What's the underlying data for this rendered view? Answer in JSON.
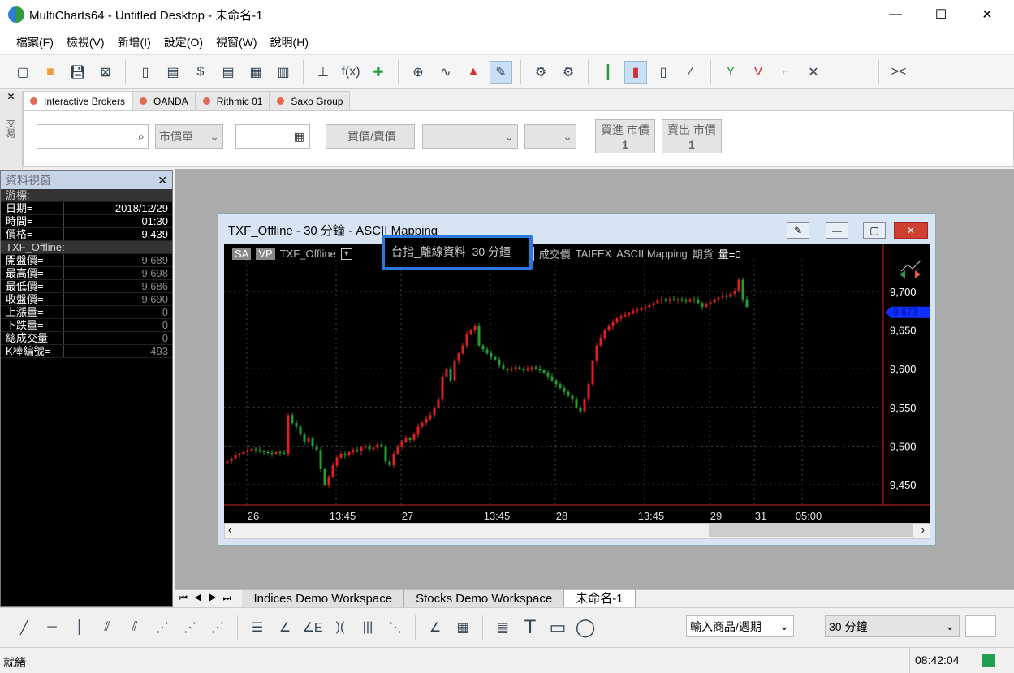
{
  "window": {
    "title": "MultiCharts64 - Untitled Desktop - 未命名-1",
    "minimize": "—",
    "maximize": "☐",
    "close": "✕"
  },
  "menu": [
    "檔案(F)",
    "檢視(V)",
    "新增(I)",
    "設定(O)",
    "視窗(W)",
    "說明(H)"
  ],
  "broker_tabs": [
    "Interactive Brokers",
    "OANDA",
    "Rithmic 01",
    "Saxo Group"
  ],
  "order_bar": {
    "side_label": "交易",
    "search_placeholder": "",
    "order_type": "市價單",
    "buysell_label": "買價/賣價",
    "buy_button": "買進 市價",
    "buy_qty": "1",
    "sell_button": "賣出 市價",
    "sell_qty": "1"
  },
  "data_window": {
    "title": "資料視窗",
    "cursor_section": "游標:",
    "cursor_rows": [
      {
        "k": "日期=",
        "v": "2018/12/29"
      },
      {
        "k": "時間=",
        "v": "01:30"
      },
      {
        "k": "價格=",
        "v": "9,439"
      }
    ],
    "symbol_section": "TXF_Offline:",
    "symbol_rows": [
      {
        "k": "開盤價=",
        "v": "9,689"
      },
      {
        "k": "最高價=",
        "v": "9,698"
      },
      {
        "k": "最低價=",
        "v": "9,686"
      },
      {
        "k": "收盤價=",
        "v": "9,690"
      },
      {
        "k": "上漲量=",
        "v": "0"
      },
      {
        "k": "下跌量=",
        "v": "0"
      },
      {
        "k": "總成交量",
        "v": "0"
      },
      {
        "k": "K棒編號=",
        "v": "493"
      }
    ]
  },
  "chart_window": {
    "title": "TXF_Offline - 30 分鐘 - ASCII Mapping",
    "status_line": {
      "sa": "SA",
      "vp": "VP",
      "symbol": "TXF_Offline",
      "desc": "台指_離線資料",
      "interval": "30 分鐘",
      "r": "R",
      "price_type": "成交價",
      "exchange": "TAIFEX",
      "source": "ASCII Mapping",
      "category": "期貨",
      "volume": "量=0"
    }
  },
  "chart_data": {
    "type": "candlestick",
    "y_ticks": [
      9450,
      9500,
      9550,
      9600,
      9650,
      9700
    ],
    "y_tick_labels": [
      "9,450",
      "9,500",
      "9,550",
      "9,600",
      "9,650",
      "9,700"
    ],
    "ylim": [
      9420,
      9740
    ],
    "x_tick_labels": [
      "26",
      "13:45",
      "27",
      "13:45",
      "28",
      "13:45",
      "29",
      "31",
      "05:00"
    ],
    "last_price_label": "9,673",
    "colors": {
      "up": "#e02020",
      "down": "#20a030",
      "axis": "#d02020",
      "last": "#1030ff"
    },
    "closes": [
      9480,
      9484,
      9488,
      9490,
      9492,
      9494,
      9496,
      9495,
      9493,
      9492,
      9491,
      9490,
      9492,
      9491,
      9490,
      9540,
      9530,
      9525,
      9515,
      9505,
      9510,
      9500,
      9495,
      9470,
      9450,
      9460,
      9475,
      9485,
      9490,
      9488,
      9492,
      9495,
      9493,
      9498,
      9500,
      9496,
      9498,
      9502,
      9500,
      9480,
      9475,
      9490,
      9500,
      9505,
      9510,
      9508,
      9515,
      9525,
      9530,
      9535,
      9540,
      9550,
      9560,
      9590,
      9600,
      9585,
      9610,
      9620,
      9630,
      9645,
      9650,
      9655,
      9630,
      9625,
      9620,
      9615,
      9612,
      9605,
      9600,
      9598,
      9600,
      9602,
      9600,
      9598,
      9600,
      9602,
      9600,
      9598,
      9595,
      9590,
      9585,
      9580,
      9575,
      9570,
      9565,
      9560,
      9550,
      9545,
      9560,
      9580,
      9610,
      9630,
      9640,
      9650,
      9655,
      9660,
      9665,
      9668,
      9670,
      9672,
      9675,
      9676,
      9678,
      9680,
      9682,
      9685,
      9688,
      9690,
      9688,
      9690,
      9689,
      9690,
      9688,
      9687,
      9690,
      9689,
      9685,
      9680,
      9683,
      9686,
      9690,
      9692,
      9695,
      9693,
      9697,
      9700,
      9715,
      9690,
      9680
    ]
  },
  "workspace_tabs": [
    "Indices Demo Workspace",
    "Stocks Demo Workspace",
    "未命名-1"
  ],
  "bottom": {
    "symbol_input": "輸入商品/週期",
    "interval": "30 分鐘"
  },
  "status": {
    "text": "就緒",
    "time": "08:42:04"
  }
}
